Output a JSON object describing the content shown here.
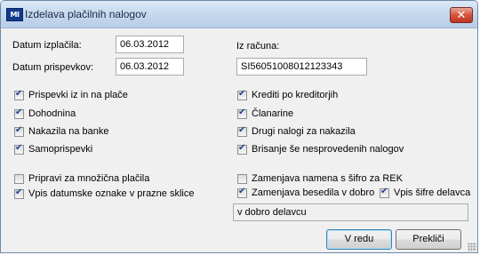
{
  "window": {
    "title": "Izdelava plačilnih nalogov",
    "close_glyph": "✕",
    "icon_text": "MI"
  },
  "fields": {
    "datum_izplacila_label": "Datum izplačila:",
    "datum_izplacila_value": "06.03.2012",
    "datum_prispevkov_label": "Datum prispevkov:",
    "datum_prispevkov_value": "06.03.2012",
    "iz_racuna_label": "Iz računa:",
    "iz_racuna_value": "SI56051008012123343"
  },
  "checkboxes_left": [
    {
      "label": "Prispevki iz in na plače",
      "checked": true
    },
    {
      "label": "Dohodnina",
      "checked": true
    },
    {
      "label": "Nakazila na banke",
      "checked": true
    },
    {
      "label": "Samoprispevki",
      "checked": true
    }
  ],
  "checkboxes_right": [
    {
      "label": "Krediti po kreditorjih",
      "checked": true
    },
    {
      "label": "Članarine",
      "checked": true
    },
    {
      "label": "Drugi nalogi za nakazila",
      "checked": true
    },
    {
      "label": "Brisanje še nesprovedenih nalogov",
      "checked": true
    }
  ],
  "options_left": [
    {
      "label": "Pripravi za množična plačila",
      "checked": false
    },
    {
      "label": "Vpis datumske oznake v prazne sklice",
      "checked": true
    }
  ],
  "options_right": [
    {
      "label": "Zamenjava namena s šifro za REK",
      "checked": false
    },
    {
      "label": "Zamenjava besedila v dobro",
      "checked": true
    },
    {
      "label": "Vpis šifre delavca",
      "checked": true
    }
  ],
  "replacement_text": "v dobro delavcu",
  "buttons": {
    "ok": "V redu",
    "cancel": "Prekliči"
  }
}
